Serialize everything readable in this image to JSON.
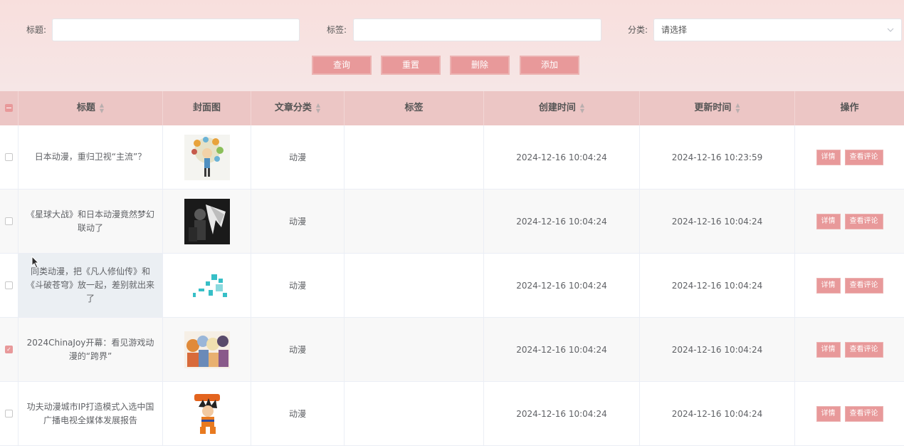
{
  "filters": {
    "title_label": "标题:",
    "title_value": "",
    "tag_label": "标签:",
    "tag_value": "",
    "category_label": "分类:",
    "category_placeholder": "请选择"
  },
  "buttons": {
    "search": "查询",
    "reset": "重置",
    "delete": "删除",
    "add": "添加"
  },
  "table": {
    "headers": {
      "title": "标题",
      "cover": "封面图",
      "category": "文章分类",
      "tags": "标签",
      "created": "创建时间",
      "updated": "更新时间",
      "actions": "操作"
    },
    "rows": [
      {
        "title": "日本动漫，重归卫视“主流”？",
        "category": "动漫",
        "tags": "",
        "created": "2024-12-16 10:04:24",
        "updated": "2024-12-16 10:23:59",
        "checked": false
      },
      {
        "title": "《星球大战》和日本动漫竟然梦幻联动了",
        "category": "动漫",
        "tags": "",
        "created": "2024-12-16 10:04:24",
        "updated": "2024-12-16 10:04:24",
        "checked": false
      },
      {
        "title": "同类动漫，把《凡人修仙传》和《斗破苍穹》放一起，差别就出来了",
        "category": "动漫",
        "tags": "",
        "created": "2024-12-16 10:04:24",
        "updated": "2024-12-16 10:04:24",
        "checked": false
      },
      {
        "title": "2024ChinaJoy开幕：看见游戏动漫的“跨界”",
        "category": "动漫",
        "tags": "",
        "created": "2024-12-16 10:04:24",
        "updated": "2024-12-16 10:04:24",
        "checked": true
      },
      {
        "title": "功夫动漫城市IP打造模式入选中国广播电视全媒体发展报告",
        "category": "动漫",
        "tags": "",
        "created": "2024-12-16 10:04:24",
        "updated": "2024-12-16 10:04:24",
        "checked": false
      }
    ],
    "row_actions": {
      "detail": "详情",
      "comments": "查看评论"
    }
  },
  "colors": {
    "accent": "#e8999a",
    "header_bg": "#ecc6c5",
    "filter_bg": "#f8dfdd"
  }
}
